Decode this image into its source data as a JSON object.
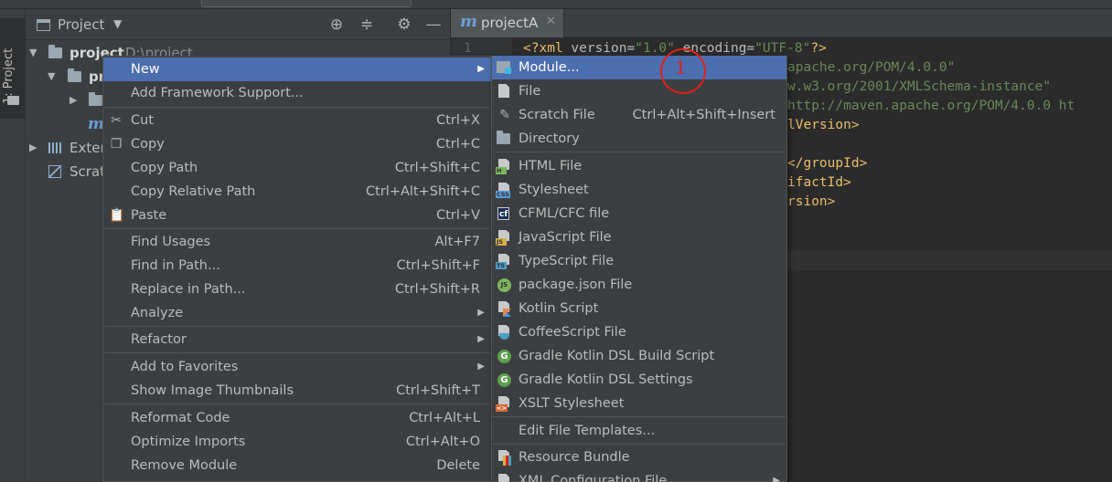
{
  "side_strip": {
    "tab_label": "1: Project"
  },
  "project_panel": {
    "title": "Project",
    "tools": [
      "target-icon",
      "collapse-icon",
      "gear-icon",
      "minimize-icon"
    ],
    "tree": [
      {
        "label": "project",
        "path": "D:\\project"
      },
      {
        "label": "pr"
      },
      {
        "label": ""
      },
      {
        "label": "m"
      },
      {
        "label": "Exter"
      },
      {
        "label": "Scrat"
      }
    ]
  },
  "editor": {
    "tab_name": "projectA",
    "line_number": "1",
    "lines": [
      {
        "a": "<?xml ",
        "b": "version=",
        "c": "\"1.0\"",
        "d": " encoding=",
        "e": "\"UTF-8\"",
        "f": "?>"
      },
      {
        "text": "apache.org/POM/4.0.0\""
      },
      {
        "text": "w.w3.org/2001/XMLSchema-instance\""
      },
      {
        "text": "http://maven.apache.org/POM/4.0.0 ht"
      },
      {
        "text": "lVersion>"
      },
      {
        "text": "</groupId>"
      },
      {
        "text": "ifactId>"
      },
      {
        "text": "rsion>"
      }
    ]
  },
  "context_menu": {
    "items": [
      {
        "label": "New",
        "shortcut": "",
        "submenu": true
      },
      {
        "label": "Add Framework Support...",
        "shortcut": ""
      },
      {
        "label": "Cut",
        "shortcut": "Ctrl+X",
        "icon": "scissors-icon"
      },
      {
        "label": "Copy",
        "shortcut": "Ctrl+C",
        "icon": "copy-icon"
      },
      {
        "label": "Copy Path",
        "shortcut": "Ctrl+Shift+C"
      },
      {
        "label": "Copy Relative Path",
        "shortcut": "Ctrl+Alt+Shift+C"
      },
      {
        "label": "Paste",
        "shortcut": "Ctrl+V",
        "icon": "clipboard-icon"
      },
      {
        "label": "Find Usages",
        "shortcut": "Alt+F7"
      },
      {
        "label": "Find in Path...",
        "shortcut": "Ctrl+Shift+F"
      },
      {
        "label": "Replace in Path...",
        "shortcut": "Ctrl+Shift+R"
      },
      {
        "label": "Analyze",
        "shortcut": "",
        "submenu": true
      },
      {
        "label": "Refactor",
        "shortcut": "",
        "submenu": true
      },
      {
        "label": "Add to Favorites",
        "shortcut": "",
        "submenu": true
      },
      {
        "label": "Show Image Thumbnails",
        "shortcut": "Ctrl+Shift+T"
      },
      {
        "label": "Reformat Code",
        "shortcut": "Ctrl+Alt+L"
      },
      {
        "label": "Optimize Imports",
        "shortcut": "Ctrl+Alt+O"
      },
      {
        "label": "Remove Module",
        "shortcut": "Delete"
      }
    ]
  },
  "new_submenu": {
    "items": [
      {
        "label": "Module...",
        "shortcut": ""
      },
      {
        "label": "File",
        "shortcut": ""
      },
      {
        "label": "Scratch File",
        "shortcut": "Ctrl+Alt+Shift+Insert"
      },
      {
        "label": "Directory",
        "shortcut": ""
      },
      {
        "label": "HTML File",
        "badge": "H"
      },
      {
        "label": "Stylesheet",
        "badge": "CSS"
      },
      {
        "label": "CFML/CFC file",
        "badge": "cf"
      },
      {
        "label": "JavaScript File",
        "badge": "JS"
      },
      {
        "label": "TypeScript File",
        "badge": "TS"
      },
      {
        "label": "package.json File",
        "badge": "JS"
      },
      {
        "label": "Kotlin Script"
      },
      {
        "label": "CoffeeScript File"
      },
      {
        "label": "Gradle Kotlin DSL Build Script",
        "badge": "G"
      },
      {
        "label": "Gradle Kotlin DSL Settings",
        "badge": "G"
      },
      {
        "label": "XSLT Stylesheet",
        "badge": "<>"
      },
      {
        "label": "Edit File Templates..."
      },
      {
        "label": "Resource Bundle"
      },
      {
        "label": "XML Configuration File",
        "submenu": true
      }
    ]
  },
  "annotation": {
    "number": "1",
    "color": "#e0201a"
  },
  "colors": {
    "selection": "#4b6eaf",
    "menu_bg": "#3c3f41",
    "editor_bg": "#2b2b2b"
  }
}
